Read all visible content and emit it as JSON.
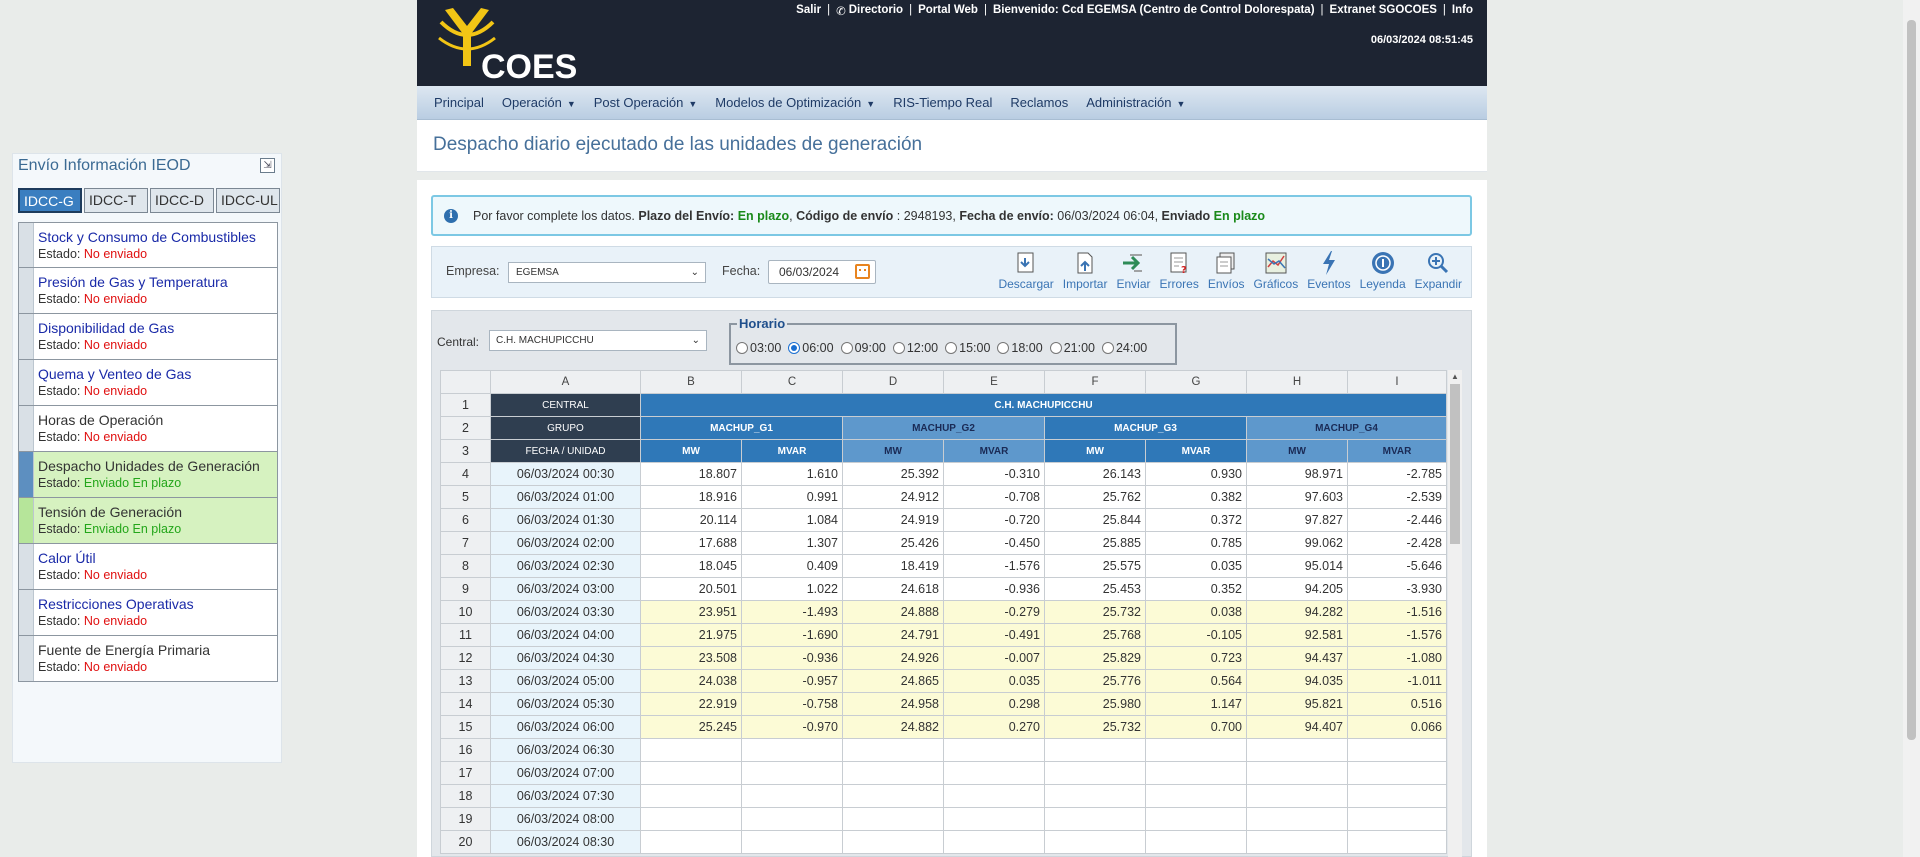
{
  "side": {
    "title": "Envío Información IEOD",
    "tabs": [
      "IDCC-G",
      "IDCC-T",
      "IDCC-D",
      "IDCC-UL"
    ],
    "status_prefix": "Estado:",
    "items": [
      {
        "name": "Stock y Consumo de Combustibles",
        "status": "No enviado"
      },
      {
        "name": "Presión de Gas y Temperatura",
        "status": "No enviado"
      },
      {
        "name": "Disponibilidad de Gas",
        "status": "No enviado"
      },
      {
        "name": "Quema y Venteo de Gas",
        "status": "No enviado"
      },
      {
        "name": "Horas de Operación",
        "status": "No enviado"
      },
      {
        "name": "Despacho Unidades de Generación",
        "status": "Enviado En plazo"
      },
      {
        "name": "Tensión de Generación",
        "status": "Enviado En plazo"
      },
      {
        "name": "Calor Útil",
        "status": "No enviado"
      },
      {
        "name": "Restricciones Operativas",
        "status": "No enviado"
      },
      {
        "name": "Fuente de Energía Primaria",
        "status": "No enviado"
      }
    ]
  },
  "header": {
    "logo_text": "COES",
    "links": [
      "Salir",
      "Directorio",
      "Portal Web",
      "Bienvenido: Ccd EGEMSA (Centro de Control Dolorespata)",
      "Extranet SGOCOES",
      "Info"
    ],
    "datetime": "06/03/2024 08:51:45"
  },
  "menu": [
    {
      "label": "Principal",
      "caret": false
    },
    {
      "label": "Operación",
      "caret": true
    },
    {
      "label": "Post Operación",
      "caret": true
    },
    {
      "label": "Modelos de Optimización",
      "caret": true
    },
    {
      "label": "RIS-Tiempo Real",
      "caret": false
    },
    {
      "label": "Reclamos",
      "caret": false
    },
    {
      "label": "Administración",
      "caret": true
    }
  ],
  "page": {
    "title": "Despacho diario ejecutado de las unidades de generación"
  },
  "info": {
    "t1": "Por favor complete los datos. ",
    "plazo_label": "Plazo del Envío:",
    "plazo_value": "En plazo",
    "codigo_label": "Código de envío",
    "codigo_value": " : 2948193, ",
    "fecha_label": "Fecha de envío:",
    "fecha_value": " 06/03/2024 06:04, ",
    "enviado_label": "Enviado",
    "enviado_value": "En plazo"
  },
  "toolbar": {
    "empresa_label": "Empresa:",
    "empresa_value": "EGEMSA",
    "fecha_label": "Fecha:",
    "fecha_value": "06/03/2024",
    "tools": [
      {
        "label": "Descargar",
        "icon": "download-icon"
      },
      {
        "label": "Importar",
        "icon": "import-icon"
      },
      {
        "label": "Enviar",
        "icon": "send-icon"
      },
      {
        "label": "Errores",
        "icon": "errors-icon"
      },
      {
        "label": "Envíos",
        "icon": "shipments-icon"
      },
      {
        "label": "Gráficos",
        "icon": "chart-icon"
      },
      {
        "label": "Eventos",
        "icon": "lightning-icon"
      },
      {
        "label": "Leyenda",
        "icon": "info-circle-icon"
      },
      {
        "label": "Expandir",
        "icon": "zoom-icon"
      }
    ]
  },
  "central": {
    "label": "Central:",
    "value": "C.H. MACHUPICCHU"
  },
  "horario": {
    "legend": "Horario",
    "options": [
      "03:00",
      "06:00",
      "09:00",
      "12:00",
      "15:00",
      "18:00",
      "21:00",
      "24:00"
    ],
    "selected": "06:00"
  },
  "grid": {
    "col_letters": [
      "A",
      "B",
      "C",
      "D",
      "E",
      "F",
      "G",
      "H",
      "I"
    ],
    "row1": {
      "label": "CENTRAL",
      "value": "C.H. MACHUPICCHU"
    },
    "row2": {
      "label": "GRUPO",
      "groups": [
        "MACHUP_G1",
        "MACHUP_G2",
        "MACHUP_G3",
        "MACHUP_G4"
      ]
    },
    "row3": {
      "label": "FECHA / UNIDAD",
      "units": [
        "MW",
        "MVAR",
        "MW",
        "MVAR",
        "MW",
        "MVAR",
        "MW",
        "MVAR"
      ]
    },
    "rows": [
      {
        "n": "4",
        "date": "06/03/2024 00:30",
        "v": [
          "18.807",
          "1.610",
          "25.392",
          "-0.310",
          "26.143",
          "0.930",
          "98.971",
          "-2.785"
        ],
        "hl": false
      },
      {
        "n": "5",
        "date": "06/03/2024 01:00",
        "v": [
          "18.916",
          "0.991",
          "24.912",
          "-0.708",
          "25.762",
          "0.382",
          "97.603",
          "-2.539"
        ],
        "hl": false
      },
      {
        "n": "6",
        "date": "06/03/2024 01:30",
        "v": [
          "20.114",
          "1.084",
          "24.919",
          "-0.720",
          "25.844",
          "0.372",
          "97.827",
          "-2.446"
        ],
        "hl": false
      },
      {
        "n": "7",
        "date": "06/03/2024 02:00",
        "v": [
          "17.688",
          "1.307",
          "25.426",
          "-0.450",
          "25.885",
          "0.785",
          "99.062",
          "-2.428"
        ],
        "hl": false
      },
      {
        "n": "8",
        "date": "06/03/2024 02:30",
        "v": [
          "18.045",
          "0.409",
          "18.419",
          "-1.576",
          "25.575",
          "0.035",
          "95.014",
          "-5.646"
        ],
        "hl": false
      },
      {
        "n": "9",
        "date": "06/03/2024 03:00",
        "v": [
          "20.501",
          "1.022",
          "24.618",
          "-0.936",
          "25.453",
          "0.352",
          "94.205",
          "-3.930"
        ],
        "hl": false
      },
      {
        "n": "10",
        "date": "06/03/2024 03:30",
        "v": [
          "23.951",
          "-1.493",
          "24.888",
          "-0.279",
          "25.732",
          "0.038",
          "94.282",
          "-1.516"
        ],
        "hl": true
      },
      {
        "n": "11",
        "date": "06/03/2024 04:00",
        "v": [
          "21.975",
          "-1.690",
          "24.791",
          "-0.491",
          "25.768",
          "-0.105",
          "92.581",
          "-1.576"
        ],
        "hl": true
      },
      {
        "n": "12",
        "date": "06/03/2024 04:30",
        "v": [
          "23.508",
          "-0.936",
          "24.926",
          "-0.007",
          "25.829",
          "0.723",
          "94.437",
          "-1.080"
        ],
        "hl": true
      },
      {
        "n": "13",
        "date": "06/03/2024 05:00",
        "v": [
          "24.038",
          "-0.957",
          "24.865",
          "0.035",
          "25.776",
          "0.564",
          "94.035",
          "-1.011"
        ],
        "hl": true
      },
      {
        "n": "14",
        "date": "06/03/2024 05:30",
        "v": [
          "22.919",
          "-0.758",
          "24.958",
          "0.298",
          "25.980",
          "1.147",
          "95.821",
          "0.516"
        ],
        "hl": true
      },
      {
        "n": "15",
        "date": "06/03/2024 06:00",
        "v": [
          "25.245",
          "-0.970",
          "24.882",
          "0.270",
          "25.732",
          "0.700",
          "94.407",
          "0.066"
        ],
        "hl": true
      },
      {
        "n": "16",
        "date": "06/03/2024 06:30",
        "v": [
          "",
          "",
          "",
          "",
          "",
          "",
          "",
          ""
        ],
        "hl": false
      },
      {
        "n": "17",
        "date": "06/03/2024 07:00",
        "v": [
          "",
          "",
          "",
          "",
          "",
          "",
          "",
          ""
        ],
        "hl": false
      },
      {
        "n": "18",
        "date": "06/03/2024 07:30",
        "v": [
          "",
          "",
          "",
          "",
          "",
          "",
          "",
          ""
        ],
        "hl": false
      },
      {
        "n": "19",
        "date": "06/03/2024 08:00",
        "v": [
          "",
          "",
          "",
          "",
          "",
          "",
          "",
          ""
        ],
        "hl": false
      },
      {
        "n": "20",
        "date": "06/03/2024 08:30",
        "v": [
          "",
          "",
          "",
          "",
          "",
          "",
          "",
          ""
        ],
        "hl": false
      }
    ]
  },
  "colors": {
    "header_bg": "#1d2432",
    "accent_blue": "#2f78b8",
    "status_red": "#e01010",
    "status_green": "#23a61a",
    "row_highlight": "#fcfbd6"
  }
}
